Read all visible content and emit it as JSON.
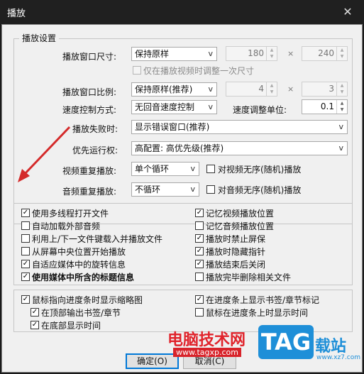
{
  "window": {
    "title": "播放",
    "close_icon": "✕"
  },
  "group": {
    "title": "播放设置"
  },
  "rows": {
    "window_size": {
      "label": "播放窗口尺寸:",
      "value": "保持原样",
      "width": "180",
      "height": "240",
      "times": "×"
    },
    "only_adjust_once": {
      "label": "仅在播放视频时调整一次尺寸",
      "checked": false
    },
    "window_ratio": {
      "label": "播放窗口比例:",
      "value": "保持原样(推荐)",
      "w": "4",
      "h": "3",
      "times": "×"
    },
    "speed_mode": {
      "label": "速度控制方式:",
      "value": "无回音速度控制",
      "unit_label": "速度调整单位:",
      "unit_value": "0.1"
    },
    "play_fail": {
      "label": "播放失败时:",
      "value": "显示错误窗口(推荐)"
    },
    "priority": {
      "label": "优先运行权:",
      "value": "高配置: 高优先级(推荐)"
    },
    "video_repeat": {
      "label": "视频重复播放:",
      "value": "单个循环",
      "shuffle_label": "对视频无序(随机)播放",
      "shuffle_checked": false
    },
    "audio_repeat": {
      "label": "音频重复播放:",
      "value": "不循环",
      "shuffle_label": "对音频无序(随机)播放",
      "shuffle_checked": false
    }
  },
  "options_left": [
    {
      "label": "使用多线程打开文件",
      "checked": true
    },
    {
      "label": "自动加载外部音频",
      "checked": false
    },
    {
      "label": "利用上/下一文件键载入并播放文件",
      "checked": false
    },
    {
      "label": "从屏幕中央位置开始播放",
      "checked": false
    },
    {
      "label": "自适应媒体中的旋转信息",
      "checked": true
    },
    {
      "label": "使用媒体中所含的标题信息",
      "checked": true
    }
  ],
  "options_right": [
    {
      "label": "记忆视频播放位置",
      "checked": true
    },
    {
      "label": "记忆音频播放位置",
      "checked": false
    },
    {
      "label": "播放时禁止屏保",
      "checked": true
    },
    {
      "label": "播放时隐藏指针",
      "checked": true
    },
    {
      "label": "播放结束后关闭",
      "checked": true
    },
    {
      "label": "播放完毕删除相关文件",
      "checked": false
    }
  ],
  "thumb": {
    "main": {
      "label": "鼠标指向进度条时显示缩略图",
      "checked": true
    },
    "top_output": {
      "label": "在顶部输出书签/章节",
      "checked": true
    },
    "bottom_time": {
      "label": "在底部显示时间",
      "checked": true
    },
    "show_bookmarks": {
      "label": "在进度条上显示书签/章节标记",
      "checked": true
    },
    "show_time": {
      "label": "鼠标在进度条上时显示时间",
      "checked": false
    }
  },
  "buttons": {
    "ok": "确定(O)",
    "cancel": "取消(C)"
  },
  "watermark": {
    "site_cn": "电脑技术网",
    "site_url": "www.tagxp.com",
    "tag": "TAG",
    "zhan": "载站",
    "small": "www.xz7.com"
  },
  "icons": {
    "checkmark": "✓",
    "chevron_down": "v",
    "spin_up": "▲",
    "spin_down": "▼"
  },
  "colors": {
    "arrow": "#d42a2a",
    "default_button_border": "#0078d7"
  }
}
